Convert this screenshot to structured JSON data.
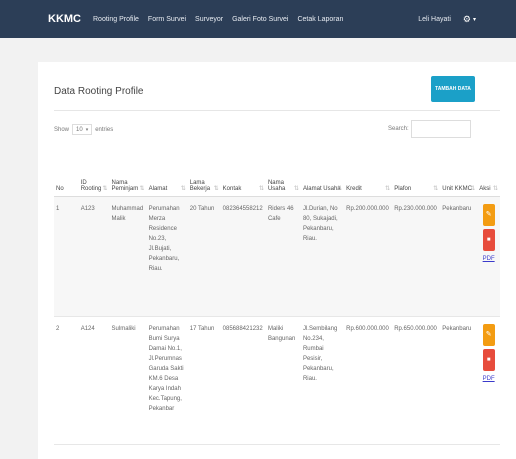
{
  "navbar": {
    "brand": "KKMC",
    "items": [
      "Rooting Profile",
      "Form Survei",
      "Surveyor",
      "Galeri Foto Survei",
      "Cetak Laporan"
    ],
    "user": "Leli Hayati",
    "settings_icon": "gear-icon"
  },
  "panel": {
    "title": "Data Rooting Profile",
    "add_button": "TAMBAH DATA",
    "show_label": "Show",
    "show_value": "10",
    "entries_label": "entries",
    "search_label": "Search:"
  },
  "table": {
    "headers": [
      "No",
      "ID Rooting",
      "Nama Peminjam",
      "Alamat",
      "Lama Bekerja",
      "Kontak",
      "Nama Usaha",
      "Alamat Usaha",
      "Kredit",
      "Plafon",
      "Unit KKMC",
      "Aksi"
    ],
    "rows": [
      {
        "no": "1",
        "id": "A123",
        "nama": "Muhammad Malik",
        "alamat": "Perumahan Merza Residence No.23, Jl.Bujati, Pekanbaru, Riau.",
        "lama": "20 Tahun",
        "kontak": "082364558212",
        "usaha": "Riders 46 Cafe",
        "alamat_usaha": "Jl.Durian, No 80, Sukajadi, Pekanbaru, Riau.",
        "kredit": "Rp.200.000.000",
        "plafon": "Rp.230.000.000",
        "unit": "Pekanbaru",
        "pdf": "PDF"
      },
      {
        "no": "2",
        "id": "A124",
        "nama": "Sulmaliki",
        "alamat": "Perumahan Bumi Surya Damai No.1, Jl.Perumnas Garuda Sakti KM.6 Desa Karya Indah Kec.Tapung, Pekanbar",
        "lama": "17 Tahun",
        "kontak": "085688421232",
        "usaha": "Maliki Bangunan",
        "alamat_usaha": "Jl.Sembilang No.234, Rumbai Pesisir, Pekanbaru, Riau.",
        "kredit": "Rp.600.000.000",
        "plafon": "Rp.650.000.000",
        "unit": "Pekanbaru",
        "pdf": "PDF"
      }
    ]
  },
  "colors": {
    "navbar": "#2c3e57",
    "add_button": "#1ba0c8",
    "edit_button": "#f39c12",
    "delete_button": "#e74c3c"
  }
}
